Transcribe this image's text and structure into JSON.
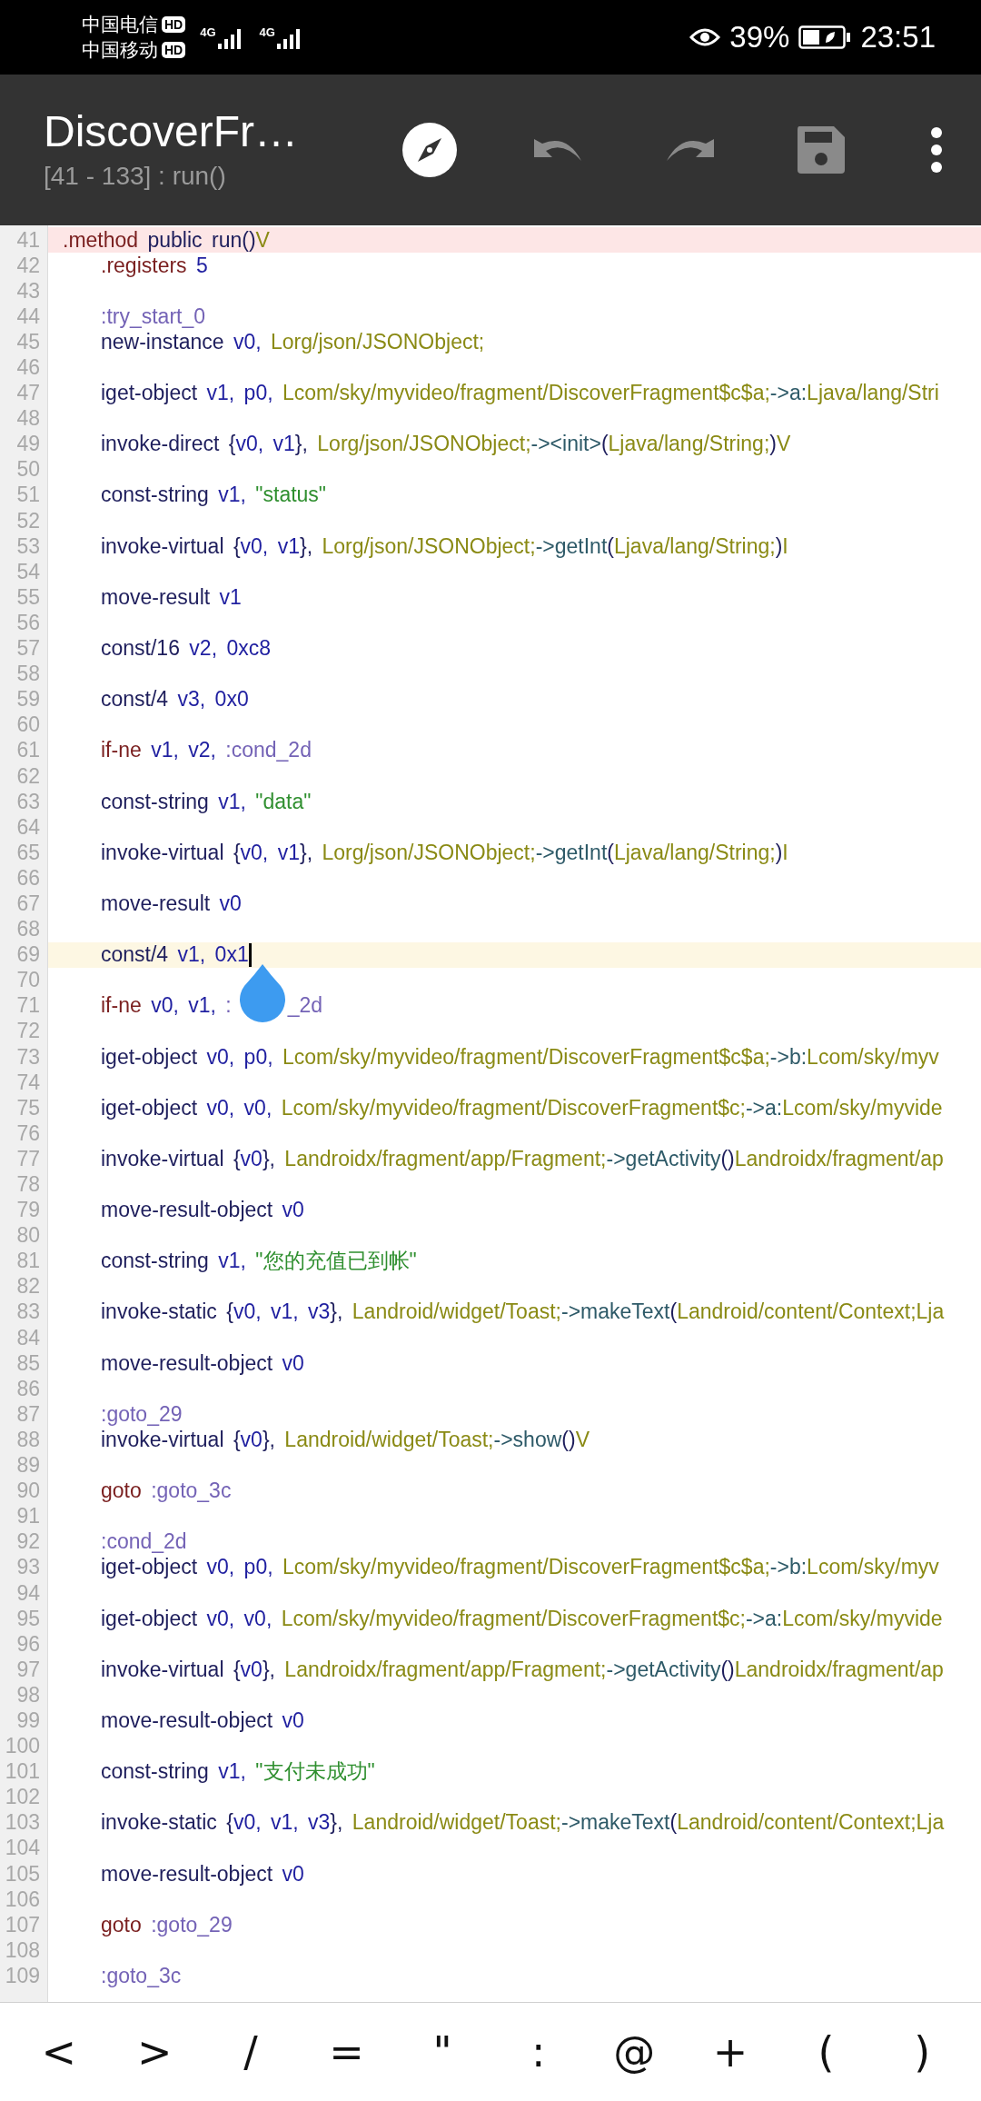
{
  "status_bar": {
    "carriers": [
      {
        "name": "中国电信",
        "badge": "HD"
      },
      {
        "name": "中国移动",
        "badge": "HD"
      }
    ],
    "networks": [
      "4G",
      "4G"
    ],
    "battery_text": "39%",
    "time": "23:51"
  },
  "toolbar": {
    "title": "DiscoverFr…",
    "subtitle": "[41 - 133] : run()"
  },
  "editor": {
    "lines": [
      {
        "n": "41",
        "color": "#fde6e6",
        "tokens": [
          {
            "kind": "directive",
            "text": ".method "
          },
          {
            "kind": "opcode",
            "text": "public "
          },
          {
            "kind": "opcode",
            "text": "run()"
          },
          {
            "kind": "type",
            "text": "V"
          }
        ],
        "children": [
          {
            "n": "42",
            "tokens": [
              {
                "kind": "directive",
                "text": ".registers "
              },
              {
                "kind": "register",
                "text": "5"
              }
            ]
          },
          {
            "n": "43"
          },
          {
            "n": "44",
            "tokens": [
              {
                "kind": "label",
                "text": ":try_start_0"
              }
            ]
          },
          {
            "n": "45",
            "tokens": [
              {
                "kind": "opcode",
                "text": "new-instance "
              },
              {
                "kind": "register",
                "text": "v0, "
              },
              {
                "kind": "type",
                "text": "Lorg/json/JSONObject;"
              }
            ]
          },
          {
            "n": "46"
          },
          {
            "n": "47",
            "tokens": [
              {
                "kind": "opcode",
                "text": "iget-object "
              },
              {
                "kind": "register",
                "text": "v1, p0, "
              },
              {
                "kind": "type",
                "text": "Lcom/sky/myvideo/fragment/DiscoverFragment$c$a;"
              },
              {
                "kind": "member",
                "text": "->a:"
              },
              {
                "kind": "type",
                "text": "Ljava/lang/Stri"
              }
            ]
          },
          {
            "n": "48"
          },
          {
            "n": "49",
            "tokens": [
              {
                "kind": "opcode",
                "text": "invoke-direct {"
              },
              {
                "kind": "register",
                "text": "v0, v1"
              },
              {
                "kind": "opcode",
                "text": "}, "
              },
              {
                "kind": "type",
                "text": "Lorg/json/JSONObject;"
              },
              {
                "kind": "member",
                "text": "-><init>"
              },
              {
                "kind": "opcode",
                "text": "("
              },
              {
                "kind": "type",
                "text": "Ljava/lang/String;"
              },
              {
                "kind": "opcode",
                "text": ")"
              },
              {
                "kind": "type",
                "text": "V"
              }
            ]
          },
          {
            "n": "50"
          },
          {
            "n": "51",
            "tokens": [
              {
                "kind": "opcode",
                "text": "const-string "
              },
              {
                "kind": "register",
                "text": "v1, "
              },
              {
                "kind": "string",
                "text": "\"status\""
              }
            ]
          },
          {
            "n": "52"
          },
          {
            "n": "53",
            "tokens": [
              {
                "kind": "opcode",
                "text": "invoke-virtual {"
              },
              {
                "kind": "register",
                "text": "v0, v1"
              },
              {
                "kind": "opcode",
                "text": "}, "
              },
              {
                "kind": "type",
                "text": "Lorg/json/JSONObject;"
              },
              {
                "kind": "member",
                "text": "->getInt"
              },
              {
                "kind": "opcode",
                "text": "("
              },
              {
                "kind": "type",
                "text": "Ljava/lang/String;"
              },
              {
                "kind": "opcode",
                "text": ")"
              },
              {
                "kind": "type",
                "text": "I"
              }
            ]
          },
          {
            "n": "54"
          },
          {
            "n": "55",
            "tokens": [
              {
                "kind": "opcode",
                "text": "move-result "
              },
              {
                "kind": "register",
                "text": "v1"
              }
            ]
          },
          {
            "n": "56"
          },
          {
            "n": "57",
            "tokens": [
              {
                "kind": "opcode",
                "text": "const/16 "
              },
              {
                "kind": "register",
                "text": "v2, 0xc8"
              }
            ]
          },
          {
            "n": "58"
          },
          {
            "n": "59",
            "tokens": [
              {
                "kind": "opcode",
                "text": "const/4 "
              },
              {
                "kind": "register",
                "text": "v3, 0x0"
              }
            ]
          },
          {
            "n": "60"
          },
          {
            "n": "61",
            "tokens": [
              {
                "kind": "directive",
                "text": "if-ne "
              },
              {
                "kind": "register",
                "text": "v1, v2, "
              },
              {
                "kind": "label",
                "text": ":cond_2d"
              }
            ]
          },
          {
            "n": "62"
          },
          {
            "n": "63",
            "tokens": [
              {
                "kind": "opcode",
                "text": "const-string "
              },
              {
                "kind": "register",
                "text": "v1, "
              },
              {
                "kind": "string",
                "text": "\"data\""
              }
            ]
          },
          {
            "n": "64"
          },
          {
            "n": "65",
            "tokens": [
              {
                "kind": "opcode",
                "text": "invoke-virtual {"
              },
              {
                "kind": "register",
                "text": "v0, v1"
              },
              {
                "kind": "opcode",
                "text": "}, "
              },
              {
                "kind": "type",
                "text": "Lorg/json/JSONObject;"
              },
              {
                "kind": "member",
                "text": "->getInt"
              },
              {
                "kind": "opcode",
                "text": "("
              },
              {
                "kind": "type",
                "text": "Ljava/lang/String;"
              },
              {
                "kind": "opcode",
                "text": ")"
              },
              {
                "kind": "type",
                "text": "I"
              }
            ]
          },
          {
            "n": "66"
          },
          {
            "n": "67",
            "tokens": [
              {
                "kind": "opcode",
                "text": "move-result "
              },
              {
                "kind": "register",
                "text": "v0"
              }
            ]
          },
          {
            "n": "68"
          },
          {
            "n": "69",
            "color": "#fdf7e3",
            "cursor": true,
            "tokens": [
              {
                "kind": "opcode",
                "text": "const/4 "
              },
              {
                "kind": "register",
                "text": "v1, 0x1"
              }
            ]
          },
          {
            "n": "70"
          },
          {
            "n": "71",
            "tokens": [
              {
                "kind": "directive",
                "text": "if-ne "
              },
              {
                "kind": "register",
                "text": "v0, v1, "
              },
              {
                "kind": "label",
                "text": ":"
              }
            ],
            "tokens_after_handle": [
              {
                "kind": "label",
                "text": "_2d"
              }
            ]
          },
          {
            "n": "72"
          },
          {
            "n": "73",
            "tokens": [
              {
                "kind": "opcode",
                "text": "iget-object "
              },
              {
                "kind": "register",
                "text": "v0, p0, "
              },
              {
                "kind": "type",
                "text": "Lcom/sky/myvideo/fragment/DiscoverFragment$c$a;"
              },
              {
                "kind": "member",
                "text": "->b:"
              },
              {
                "kind": "type",
                "text": "Lcom/sky/myv"
              }
            ]
          },
          {
            "n": "74"
          },
          {
            "n": "75",
            "tokens": [
              {
                "kind": "opcode",
                "text": "iget-object "
              },
              {
                "kind": "register",
                "text": "v0, v0, "
              },
              {
                "kind": "type",
                "text": "Lcom/sky/myvideo/fragment/DiscoverFragment$c;"
              },
              {
                "kind": "member",
                "text": "->a:"
              },
              {
                "kind": "type",
                "text": "Lcom/sky/myvide"
              }
            ]
          },
          {
            "n": "76"
          },
          {
            "n": "77",
            "tokens": [
              {
                "kind": "opcode",
                "text": "invoke-virtual {"
              },
              {
                "kind": "register",
                "text": "v0"
              },
              {
                "kind": "opcode",
                "text": "}, "
              },
              {
                "kind": "type",
                "text": "Landroidx/fragment/app/Fragment;"
              },
              {
                "kind": "member",
                "text": "->getActivity"
              },
              {
                "kind": "opcode",
                "text": "()"
              },
              {
                "kind": "type",
                "text": "Landroidx/fragment/ap"
              }
            ]
          },
          {
            "n": "78"
          },
          {
            "n": "79",
            "tokens": [
              {
                "kind": "opcode",
                "text": "move-result-object "
              },
              {
                "kind": "register",
                "text": "v0"
              }
            ]
          },
          {
            "n": "80"
          },
          {
            "n": "81",
            "tokens": [
              {
                "kind": "opcode",
                "text": "const-string "
              },
              {
                "kind": "register",
                "text": "v1, "
              },
              {
                "kind": "string",
                "text": "\"您的充值已到帐\""
              }
            ]
          },
          {
            "n": "82"
          },
          {
            "n": "83",
            "tokens": [
              {
                "kind": "opcode",
                "text": "invoke-static {"
              },
              {
                "kind": "register",
                "text": "v0, v1, v3"
              },
              {
                "kind": "opcode",
                "text": "}, "
              },
              {
                "kind": "type",
                "text": "Landroid/widget/Toast;"
              },
              {
                "kind": "member",
                "text": "->makeText"
              },
              {
                "kind": "opcode",
                "text": "("
              },
              {
                "kind": "type",
                "text": "Landroid/content/Context;Lja"
              }
            ]
          },
          {
            "n": "84"
          },
          {
            "n": "85",
            "tokens": [
              {
                "kind": "opcode",
                "text": "move-result-object "
              },
              {
                "kind": "register",
                "text": "v0"
              }
            ]
          },
          {
            "n": "86"
          },
          {
            "n": "87",
            "tokens": [
              {
                "kind": "label",
                "text": ":goto_29"
              }
            ]
          },
          {
            "n": "88",
            "tokens": [
              {
                "kind": "opcode",
                "text": "invoke-virtual {"
              },
              {
                "kind": "register",
                "text": "v0"
              },
              {
                "kind": "opcode",
                "text": "}, "
              },
              {
                "kind": "type",
                "text": "Landroid/widget/Toast;"
              },
              {
                "kind": "member",
                "text": "->show"
              },
              {
                "kind": "opcode",
                "text": "()"
              },
              {
                "kind": "type",
                "text": "V"
              }
            ]
          },
          {
            "n": "89"
          },
          {
            "n": "90",
            "tokens": [
              {
                "kind": "directive",
                "text": "goto "
              },
              {
                "kind": "label",
                "text": ":goto_3c"
              }
            ]
          },
          {
            "n": "91"
          },
          {
            "n": "92",
            "tokens": [
              {
                "kind": "label",
                "text": ":cond_2d"
              }
            ]
          },
          {
            "n": "93",
            "tokens": [
              {
                "kind": "opcode",
                "text": "iget-object "
              },
              {
                "kind": "register",
                "text": "v0, p0, "
              },
              {
                "kind": "type",
                "text": "Lcom/sky/myvideo/fragment/DiscoverFragment$c$a;"
              },
              {
                "kind": "member",
                "text": "->b:"
              },
              {
                "kind": "type",
                "text": "Lcom/sky/myv"
              }
            ]
          },
          {
            "n": "94"
          },
          {
            "n": "95",
            "tokens": [
              {
                "kind": "opcode",
                "text": "iget-object "
              },
              {
                "kind": "register",
                "text": "v0, v0, "
              },
              {
                "kind": "type",
                "text": "Lcom/sky/myvideo/fragment/DiscoverFragment$c;"
              },
              {
                "kind": "member",
                "text": "->a:"
              },
              {
                "kind": "type",
                "text": "Lcom/sky/myvide"
              }
            ]
          },
          {
            "n": "96"
          },
          {
            "n": "97",
            "tokens": [
              {
                "kind": "opcode",
                "text": "invoke-virtual {"
              },
              {
                "kind": "register",
                "text": "v0"
              },
              {
                "kind": "opcode",
                "text": "}, "
              },
              {
                "kind": "type",
                "text": "Landroidx/fragment/app/Fragment;"
              },
              {
                "kind": "member",
                "text": "->getActivity"
              },
              {
                "kind": "opcode",
                "text": "()"
              },
              {
                "kind": "type",
                "text": "Landroidx/fragment/ap"
              }
            ]
          },
          {
            "n": "98"
          },
          {
            "n": "99",
            "tokens": [
              {
                "kind": "opcode",
                "text": "move-result-object "
              },
              {
                "kind": "register",
                "text": "v0"
              }
            ]
          },
          {
            "n": "100"
          },
          {
            "n": "101",
            "tokens": [
              {
                "kind": "opcode",
                "text": "const-string "
              },
              {
                "kind": "register",
                "text": "v1, "
              },
              {
                "kind": "string",
                "text": "\"支付未成功\""
              }
            ]
          },
          {
            "n": "102"
          },
          {
            "n": "103",
            "tokens": [
              {
                "kind": "opcode",
                "text": "invoke-static {"
              },
              {
                "kind": "register",
                "text": "v0, v1, v3"
              },
              {
                "kind": "opcode",
                "text": "}, "
              },
              {
                "kind": "type",
                "text": "Landroid/widget/Toast;"
              },
              {
                "kind": "member",
                "text": "->makeText"
              },
              {
                "kind": "opcode",
                "text": "("
              },
              {
                "kind": "type",
                "text": "Landroid/content/Context;Lja"
              }
            ]
          },
          {
            "n": "104"
          },
          {
            "n": "105",
            "tokens": [
              {
                "kind": "opcode",
                "text": "move-result-object "
              },
              {
                "kind": "register",
                "text": "v0"
              }
            ]
          },
          {
            "n": "106"
          },
          {
            "n": "107",
            "tokens": [
              {
                "kind": "directive",
                "text": "goto "
              },
              {
                "kind": "label",
                "text": ":goto_29"
              }
            ]
          },
          {
            "n": "108"
          },
          {
            "n": "109",
            "tokens": [
              {
                "kind": "label",
                "text": ":goto_3c"
              }
            ]
          }
        ]
      }
    ]
  },
  "symbol_keys": [
    "<",
    ">",
    "/",
    "=",
    "\"",
    ":",
    "@",
    "+",
    "(",
    ")"
  ]
}
